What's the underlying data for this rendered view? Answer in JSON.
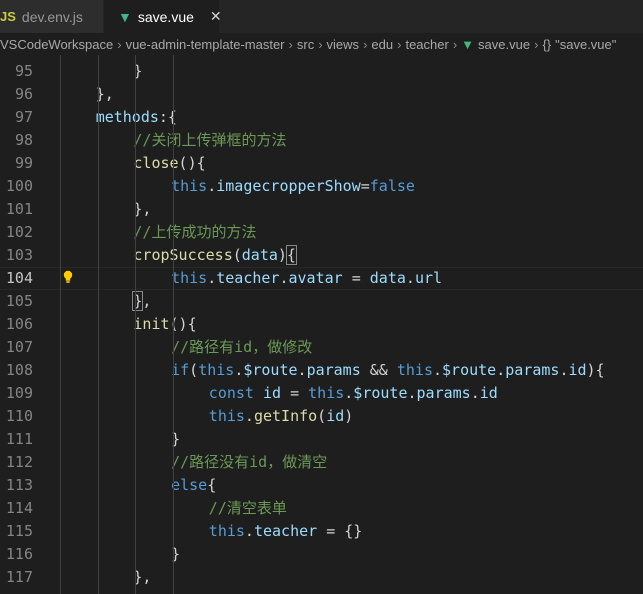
{
  "tabs": [
    {
      "name": "dev.env.js",
      "icon": "js-icon",
      "icon_label": "JS",
      "active": false
    },
    {
      "name": "save.vue",
      "icon": "vue-icon",
      "active": true
    }
  ],
  "breadcrumb": {
    "items": [
      "VSCodeWorkspace",
      "vue-admin-template-master",
      "src",
      "views",
      "edu",
      "teacher"
    ],
    "file": "save.vue",
    "symbol_icon": "{}",
    "symbol": "\"save.vue\""
  },
  "editor": {
    "current_line": "104",
    "lines": [
      {
        "num": "95",
        "indent": 2,
        "tokens": [
          [
            "pun",
            "}"
          ]
        ]
      },
      {
        "num": "96",
        "indent": 1,
        "tokens": [
          [
            "pun",
            "},"
          ]
        ]
      },
      {
        "num": "97",
        "indent": 1,
        "tokens": [
          [
            "prop",
            "methods"
          ],
          [
            "pun",
            ":{"
          ]
        ]
      },
      {
        "num": "98",
        "indent": 2,
        "tokens": [
          [
            "cmt",
            "//关闭上传弹框的方法"
          ]
        ]
      },
      {
        "num": "99",
        "indent": 2,
        "tokens": [
          [
            "fn",
            "close"
          ],
          [
            "pun",
            "(){"
          ]
        ]
      },
      {
        "num": "100",
        "indent": 3,
        "tokens": [
          [
            "kw",
            "this"
          ],
          [
            "pun",
            "."
          ],
          [
            "prop",
            "imagecropperShow"
          ],
          [
            "pun",
            "="
          ],
          [
            "kw",
            "false"
          ]
        ]
      },
      {
        "num": "101",
        "indent": 2,
        "tokens": [
          [
            "pun",
            "},"
          ]
        ]
      },
      {
        "num": "102",
        "indent": 2,
        "tokens": [
          [
            "cmt",
            "//上传成功的方法"
          ]
        ]
      },
      {
        "num": "103",
        "indent": 2,
        "tokens": [
          [
            "fn",
            "cropSuccess"
          ],
          [
            "pun",
            "("
          ],
          [
            "prop",
            "data"
          ],
          [
            "pun",
            ")"
          ],
          [
            "brk",
            "{"
          ]
        ]
      },
      {
        "num": "104",
        "indent": 3,
        "tokens": [
          [
            "kw",
            "this"
          ],
          [
            "pun",
            "."
          ],
          [
            "prop",
            "teacher"
          ],
          [
            "pun",
            "."
          ],
          [
            "prop",
            "avatar"
          ],
          [
            "pun",
            " = "
          ],
          [
            "prop",
            "data"
          ],
          [
            "pun",
            "."
          ],
          [
            "prop",
            "url"
          ]
        ]
      },
      {
        "num": "105",
        "indent": 2,
        "tokens": [
          [
            "brk",
            "}"
          ],
          [
            "pun",
            ","
          ]
        ]
      },
      {
        "num": "106",
        "indent": 2,
        "tokens": [
          [
            "fn",
            "init"
          ],
          [
            "pun",
            "(){"
          ]
        ]
      },
      {
        "num": "107",
        "indent": 3,
        "tokens": [
          [
            "cmt",
            "//路径有id，做修改"
          ]
        ]
      },
      {
        "num": "108",
        "indent": 3,
        "tokens": [
          [
            "kw",
            "if"
          ],
          [
            "pun",
            "("
          ],
          [
            "kw",
            "this"
          ],
          [
            "pun",
            "."
          ],
          [
            "prop",
            "$route"
          ],
          [
            "pun",
            "."
          ],
          [
            "prop",
            "params"
          ],
          [
            "pun",
            " && "
          ],
          [
            "kw",
            "this"
          ],
          [
            "pun",
            "."
          ],
          [
            "prop",
            "$route"
          ],
          [
            "pun",
            "."
          ],
          [
            "prop",
            "params"
          ],
          [
            "pun",
            "."
          ],
          [
            "prop",
            "id"
          ],
          [
            "pun",
            "){"
          ]
        ]
      },
      {
        "num": "109",
        "indent": 4,
        "tokens": [
          [
            "kw",
            "const"
          ],
          [
            "pun",
            " "
          ],
          [
            "prop",
            "id"
          ],
          [
            "pun",
            " = "
          ],
          [
            "kw",
            "this"
          ],
          [
            "pun",
            "."
          ],
          [
            "prop",
            "$route"
          ],
          [
            "pun",
            "."
          ],
          [
            "prop",
            "params"
          ],
          [
            "pun",
            "."
          ],
          [
            "prop",
            "id"
          ]
        ]
      },
      {
        "num": "110",
        "indent": 4,
        "tokens": [
          [
            "kw",
            "this"
          ],
          [
            "pun",
            "."
          ],
          [
            "fn",
            "getInfo"
          ],
          [
            "pun",
            "("
          ],
          [
            "prop",
            "id"
          ],
          [
            "pun",
            ")"
          ]
        ]
      },
      {
        "num": "111",
        "indent": 3,
        "tokens": [
          [
            "pun",
            "}"
          ]
        ]
      },
      {
        "num": "112",
        "indent": 3,
        "tokens": [
          [
            "cmt",
            "//路径没有id，做清空"
          ]
        ]
      },
      {
        "num": "113",
        "indent": 3,
        "tokens": [
          [
            "kw",
            "else"
          ],
          [
            "pun",
            "{"
          ]
        ]
      },
      {
        "num": "114",
        "indent": 4,
        "tokens": [
          [
            "cmt",
            "//清空表单"
          ]
        ]
      },
      {
        "num": "115",
        "indent": 4,
        "tokens": [
          [
            "kw",
            "this"
          ],
          [
            "pun",
            "."
          ],
          [
            "prop",
            "teacher"
          ],
          [
            "pun",
            " = {}"
          ]
        ]
      },
      {
        "num": "116",
        "indent": 3,
        "tokens": [
          [
            "pun",
            "}"
          ]
        ]
      },
      {
        "num": "117",
        "indent": 2,
        "tokens": [
          [
            "pun",
            "},"
          ]
        ]
      }
    ]
  },
  "colors": {
    "background": "#1e1e1e",
    "keyword": "#569cd6",
    "function": "#dcdcaa",
    "property": "#9cdcfe",
    "comment": "#6a9955"
  }
}
